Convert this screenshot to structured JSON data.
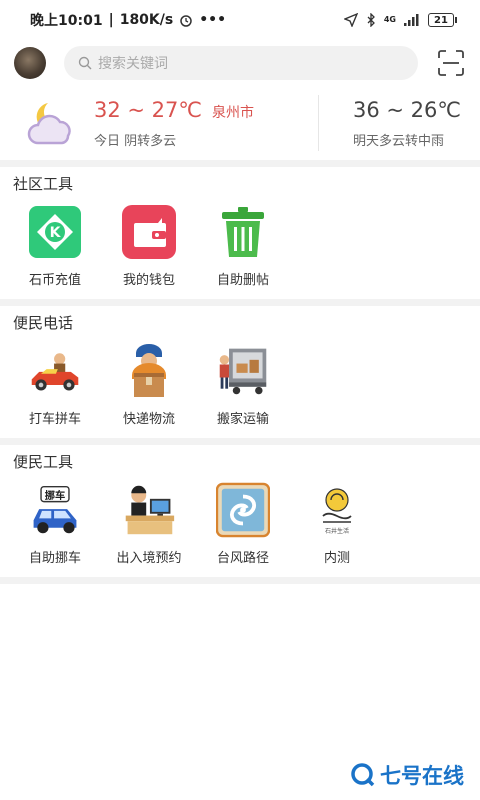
{
  "status": {
    "time": "晚上10:01",
    "speed": "180K/s",
    "network": "4G",
    "battery": "21"
  },
  "search": {
    "placeholder": "搜索关键词"
  },
  "weather": {
    "today_temp": "32 ~ 27℃",
    "city": "泉州市",
    "today_desc": "今日 阴转多云",
    "tomorrow_temp": "36 ~ 26℃",
    "tomorrow_desc": "明天多云转中雨"
  },
  "sections": [
    {
      "title": "社区工具",
      "items": [
        {
          "label": "石币充值",
          "icon": "k-coin-icon"
        },
        {
          "label": "我的钱包",
          "icon": "wallet-icon"
        },
        {
          "label": "自助删帖",
          "icon": "trash-icon"
        }
      ]
    },
    {
      "title": "便民电话",
      "items": [
        {
          "label": "打车拼车",
          "icon": "taxi-car-icon"
        },
        {
          "label": "快递物流",
          "icon": "courier-icon"
        },
        {
          "label": "搬家运输",
          "icon": "moving-truck-icon"
        }
      ]
    },
    {
      "title": "便民工具",
      "items": [
        {
          "label": "自助挪车",
          "icon": "move-car-icon",
          "badge": "挪车"
        },
        {
          "label": "出入境预约",
          "icon": "exit-entry-icon"
        },
        {
          "label": "台风路径",
          "icon": "typhoon-icon"
        },
        {
          "label": "内测",
          "icon": "beta-icon",
          "sublabel": "石井生活"
        }
      ]
    }
  ],
  "watermark": {
    "text": "七号在线"
  },
  "colors": {
    "accent_red": "#d9534f",
    "k_green": "#2fc97a",
    "wallet_red": "#e8445a",
    "trash_green": "#3aa63a",
    "watermark_blue": "#1a73c8"
  }
}
